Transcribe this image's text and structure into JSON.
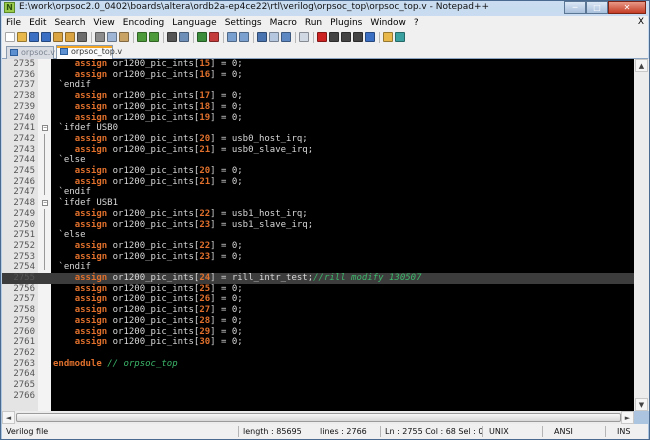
{
  "window": {
    "title": "E:\\work\\orpsoc2.0_0402\\boards\\altera\\ordb2a-ep4ce22\\rtl\\verilog\\orpsoc_top\\orpsoc_top.v - Notepad++",
    "app_icon_letter": "N",
    "controls": {
      "minimize": "─",
      "maximize": "□",
      "close": "✕"
    }
  },
  "menu": [
    "File",
    "Edit",
    "Search",
    "View",
    "Encoding",
    "Language",
    "Settings",
    "Macro",
    "Run",
    "Plugins",
    "Window",
    "?"
  ],
  "menu_close": "X",
  "toolbar": {
    "icons": [
      {
        "name": "new-file-icon",
        "color": "#ffffff"
      },
      {
        "name": "open-file-icon",
        "color": "#e8b84a"
      },
      {
        "name": "save-icon",
        "color": "#3a6fc4"
      },
      {
        "name": "save-all-icon",
        "color": "#3a6fc4"
      },
      {
        "name": "close-icon",
        "color": "#d9a441"
      },
      {
        "name": "close-all-icon",
        "color": "#d9a441"
      },
      {
        "name": "print-icon",
        "color": "#6d6d6d"
      },
      {
        "name": "sep"
      },
      {
        "name": "cut-icon",
        "color": "#8c8c8c"
      },
      {
        "name": "copy-icon",
        "color": "#9fb5d6"
      },
      {
        "name": "paste-icon",
        "color": "#c9a366"
      },
      {
        "name": "sep"
      },
      {
        "name": "undo-icon",
        "color": "#4c9a3a"
      },
      {
        "name": "redo-icon",
        "color": "#4c9a3a"
      },
      {
        "name": "sep"
      },
      {
        "name": "find-icon",
        "color": "#555555"
      },
      {
        "name": "replace-icon",
        "color": "#6d8fb8"
      },
      {
        "name": "sep"
      },
      {
        "name": "zoom-in-icon",
        "color": "#3a8c3a"
      },
      {
        "name": "zoom-out-icon",
        "color": "#c43c3c"
      },
      {
        "name": "sep"
      },
      {
        "name": "sync-v-icon",
        "color": "#7aa0d0"
      },
      {
        "name": "sync-h-icon",
        "color": "#7aa0d0"
      },
      {
        "name": "sep"
      },
      {
        "name": "word-wrap-icon",
        "color": "#4a74b0"
      },
      {
        "name": "show-all-icon",
        "color": "#b5c7df"
      },
      {
        "name": "indent-guide-icon",
        "color": "#5e88c2"
      },
      {
        "name": "sep"
      },
      {
        "name": "doc-map-icon",
        "color": "#d0d8e4"
      },
      {
        "name": "sep"
      },
      {
        "name": "record-macro-icon",
        "color": "#cc2222"
      },
      {
        "name": "stop-macro-icon",
        "color": "#444444"
      },
      {
        "name": "play-macro-icon",
        "color": "#444444"
      },
      {
        "name": "play-multiple-icon",
        "color": "#444444"
      },
      {
        "name": "save-macro-icon",
        "color": "#3a6fc4"
      },
      {
        "name": "sep"
      },
      {
        "name": "folder-icon",
        "color": "#e8b84a"
      },
      {
        "name": "spell-check-icon",
        "color": "#3aa0a0"
      }
    ]
  },
  "tabs": [
    {
      "label": "orpsoc.v",
      "active": false
    },
    {
      "label": "orpsoc_top.v",
      "active": true
    }
  ],
  "editor": {
    "current_line": 2755,
    "lines": [
      {
        "n": "2735",
        "fold": "",
        "code": [
          {
            "k": "i",
            "t": "    "
          },
          {
            "k": "kw",
            "t": "assign"
          },
          {
            "k": "p",
            "t": " or1200_pic_ints["
          },
          {
            "k": "kw",
            "t": "15"
          },
          {
            "k": "p",
            "t": "] = 0;"
          }
        ]
      },
      {
        "n": "2736",
        "fold": "",
        "code": [
          {
            "k": "i",
            "t": "    "
          },
          {
            "k": "kw",
            "t": "assign"
          },
          {
            "k": "p",
            "t": " or1200_pic_ints["
          },
          {
            "k": "kw",
            "t": "16"
          },
          {
            "k": "p",
            "t": "] = 0;"
          }
        ]
      },
      {
        "n": "2737",
        "fold": "",
        "code": [
          {
            "k": "p",
            "t": " `endif"
          }
        ]
      },
      {
        "n": "2738",
        "fold": "",
        "code": [
          {
            "k": "i",
            "t": "    "
          },
          {
            "k": "kw",
            "t": "assign"
          },
          {
            "k": "p",
            "t": " or1200_pic_ints["
          },
          {
            "k": "kw",
            "t": "17"
          },
          {
            "k": "p",
            "t": "] = 0;"
          }
        ]
      },
      {
        "n": "2739",
        "fold": "",
        "code": [
          {
            "k": "i",
            "t": "    "
          },
          {
            "k": "kw",
            "t": "assign"
          },
          {
            "k": "p",
            "t": " or1200_pic_ints["
          },
          {
            "k": "kw",
            "t": "18"
          },
          {
            "k": "p",
            "t": "] = 0;"
          }
        ]
      },
      {
        "n": "2740",
        "fold": "",
        "code": [
          {
            "k": "i",
            "t": "    "
          },
          {
            "k": "kw",
            "t": "assign"
          },
          {
            "k": "p",
            "t": " or1200_pic_ints["
          },
          {
            "k": "kw",
            "t": "19"
          },
          {
            "k": "p",
            "t": "] = 0;"
          }
        ]
      },
      {
        "n": "2741",
        "fold": "minus",
        "code": [
          {
            "k": "p",
            "t": " `ifdef USB0"
          }
        ]
      },
      {
        "n": "2742",
        "fold": "",
        "code": [
          {
            "k": "i",
            "t": "    "
          },
          {
            "k": "kw",
            "t": "assign"
          },
          {
            "k": "p",
            "t": " or1200_pic_ints["
          },
          {
            "k": "kw",
            "t": "20"
          },
          {
            "k": "p",
            "t": "] = usb0_host_irq;"
          }
        ]
      },
      {
        "n": "2743",
        "fold": "",
        "code": [
          {
            "k": "i",
            "t": "    "
          },
          {
            "k": "kw",
            "t": "assign"
          },
          {
            "k": "p",
            "t": " or1200_pic_ints["
          },
          {
            "k": "kw",
            "t": "21"
          },
          {
            "k": "p",
            "t": "] = usb0_slave_irq;"
          }
        ]
      },
      {
        "n": "2744",
        "fold": "",
        "code": [
          {
            "k": "p",
            "t": " `else"
          }
        ]
      },
      {
        "n": "2745",
        "fold": "",
        "code": [
          {
            "k": "i",
            "t": "    "
          },
          {
            "k": "kw",
            "t": "assign"
          },
          {
            "k": "p",
            "t": " or1200_pic_ints["
          },
          {
            "k": "kw",
            "t": "20"
          },
          {
            "k": "p",
            "t": "] = 0;"
          }
        ]
      },
      {
        "n": "2746",
        "fold": "",
        "code": [
          {
            "k": "i",
            "t": "    "
          },
          {
            "k": "kw",
            "t": "assign"
          },
          {
            "k": "p",
            "t": " or1200_pic_ints["
          },
          {
            "k": "kw",
            "t": "21"
          },
          {
            "k": "p",
            "t": "] = 0;"
          }
        ]
      },
      {
        "n": "2747",
        "fold": "",
        "code": [
          {
            "k": "p",
            "t": " `endif"
          }
        ]
      },
      {
        "n": "2748",
        "fold": "minus",
        "code": [
          {
            "k": "p",
            "t": " `ifdef USB1"
          }
        ]
      },
      {
        "n": "2749",
        "fold": "",
        "code": [
          {
            "k": "i",
            "t": "    "
          },
          {
            "k": "kw",
            "t": "assign"
          },
          {
            "k": "p",
            "t": " or1200_pic_ints["
          },
          {
            "k": "kw",
            "t": "22"
          },
          {
            "k": "p",
            "t": "] = usb1_host_irq;"
          }
        ]
      },
      {
        "n": "2750",
        "fold": "",
        "code": [
          {
            "k": "i",
            "t": "    "
          },
          {
            "k": "kw",
            "t": "assign"
          },
          {
            "k": "p",
            "t": " or1200_pic_ints["
          },
          {
            "k": "kw",
            "t": "23"
          },
          {
            "k": "p",
            "t": "] = usb1_slave_irq;"
          }
        ]
      },
      {
        "n": "2751",
        "fold": "",
        "code": [
          {
            "k": "p",
            "t": " `else"
          }
        ]
      },
      {
        "n": "2752",
        "fold": "",
        "code": [
          {
            "k": "i",
            "t": "    "
          },
          {
            "k": "kw",
            "t": "assign"
          },
          {
            "k": "p",
            "t": " or1200_pic_ints["
          },
          {
            "k": "kw",
            "t": "22"
          },
          {
            "k": "p",
            "t": "] = 0;"
          }
        ]
      },
      {
        "n": "2753",
        "fold": "",
        "code": [
          {
            "k": "i",
            "t": "    "
          },
          {
            "k": "kw",
            "t": "assign"
          },
          {
            "k": "p",
            "t": " or1200_pic_ints["
          },
          {
            "k": "kw",
            "t": "23"
          },
          {
            "k": "p",
            "t": "] = 0;"
          }
        ]
      },
      {
        "n": "2754",
        "fold": "",
        "code": [
          {
            "k": "p",
            "t": " `endif"
          }
        ]
      },
      {
        "n": "2755",
        "fold": "",
        "code": [
          {
            "k": "i",
            "t": "    "
          },
          {
            "k": "kw",
            "t": "assign"
          },
          {
            "k": "p",
            "t": " or1200_pic_ints["
          },
          {
            "k": "kw",
            "t": "24"
          },
          {
            "k": "p",
            "t": "] = rill_intr_test;"
          },
          {
            "k": "cm",
            "t": "//rill modify 130507"
          }
        ]
      },
      {
        "n": "2756",
        "fold": "",
        "code": [
          {
            "k": "i",
            "t": "    "
          },
          {
            "k": "kw",
            "t": "assign"
          },
          {
            "k": "p",
            "t": " or1200_pic_ints["
          },
          {
            "k": "kw",
            "t": "25"
          },
          {
            "k": "p",
            "t": "] = 0;"
          }
        ]
      },
      {
        "n": "2757",
        "fold": "",
        "code": [
          {
            "k": "i",
            "t": "    "
          },
          {
            "k": "kw",
            "t": "assign"
          },
          {
            "k": "p",
            "t": " or1200_pic_ints["
          },
          {
            "k": "kw",
            "t": "26"
          },
          {
            "k": "p",
            "t": "] = 0;"
          }
        ]
      },
      {
        "n": "2758",
        "fold": "",
        "code": [
          {
            "k": "i",
            "t": "    "
          },
          {
            "k": "kw",
            "t": "assign"
          },
          {
            "k": "p",
            "t": " or1200_pic_ints["
          },
          {
            "k": "kw",
            "t": "27"
          },
          {
            "k": "p",
            "t": "] = 0;"
          }
        ]
      },
      {
        "n": "2759",
        "fold": "",
        "code": [
          {
            "k": "i",
            "t": "    "
          },
          {
            "k": "kw",
            "t": "assign"
          },
          {
            "k": "p",
            "t": " or1200_pic_ints["
          },
          {
            "k": "kw",
            "t": "28"
          },
          {
            "k": "p",
            "t": "] = 0;"
          }
        ]
      },
      {
        "n": "2760",
        "fold": "",
        "code": [
          {
            "k": "i",
            "t": "    "
          },
          {
            "k": "kw",
            "t": "assign"
          },
          {
            "k": "p",
            "t": " or1200_pic_ints["
          },
          {
            "k": "kw",
            "t": "29"
          },
          {
            "k": "p",
            "t": "] = 0;"
          }
        ]
      },
      {
        "n": "2761",
        "fold": "",
        "code": [
          {
            "k": "i",
            "t": "    "
          },
          {
            "k": "kw",
            "t": "assign"
          },
          {
            "k": "p",
            "t": " or1200_pic_ints["
          },
          {
            "k": "kw",
            "t": "30"
          },
          {
            "k": "p",
            "t": "] = 0;"
          }
        ]
      },
      {
        "n": "2762",
        "fold": "",
        "code": []
      },
      {
        "n": "2763",
        "fold": "",
        "code": [
          {
            "k": "kw",
            "t": "endmodule"
          },
          {
            "k": "p",
            "t": " "
          },
          {
            "k": "cm",
            "t": "// orpsoc_top"
          }
        ]
      },
      {
        "n": "2764",
        "fold": "",
        "code": []
      },
      {
        "n": "2765",
        "fold": "",
        "code": []
      },
      {
        "n": "2766",
        "fold": "",
        "code": []
      }
    ]
  },
  "status": {
    "filetype": "Verilog file",
    "length": "length : 85695",
    "lines": "lines : 2766",
    "position": "Ln : 2755   Col : 68   Sel : 0",
    "eol": "UNIX",
    "encoding": "ANSI",
    "mode": "INS"
  },
  "scroll": {
    "up": "▲",
    "down": "▼",
    "left": "◄",
    "right": "►"
  },
  "colors": {
    "keyword": "#e0702c",
    "comment": "#3cb86b",
    "text": "#d8d8d8",
    "background": "#000000",
    "current_line": "#3c3c3c"
  }
}
